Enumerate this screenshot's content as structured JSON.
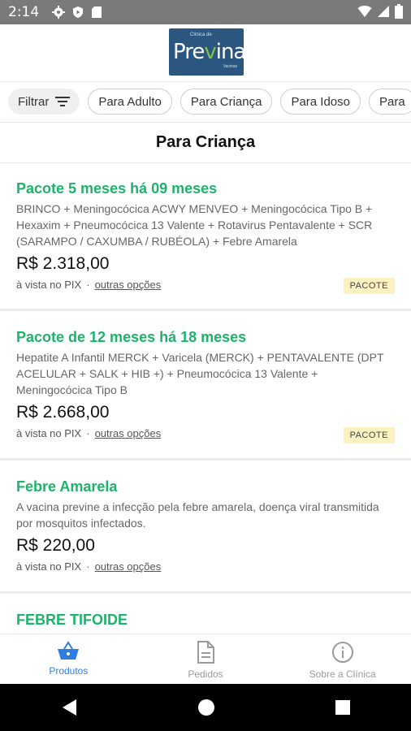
{
  "status_bar": {
    "time": "2:14"
  },
  "logo": {
    "mini_text": "Clínica de",
    "brand_part1": "Pre",
    "brand_part2": "v",
    "brand_part3": "ina",
    "sub_text": "Vacinas"
  },
  "filters": {
    "filter_label": "Filtrar",
    "chips": [
      "Para Adulto",
      "Para Criança",
      "Para Idoso",
      "Para"
    ]
  },
  "section": {
    "title": "Para Criança"
  },
  "products": [
    {
      "name": "Pacote 5 meses há 09 meses",
      "description": "BRINCO + Meningocócica ACWY MENVEO + Meningocócica Tipo B + Hexaxim + Pneumocócica 13 Valente + Rotavirus Pentavalente + SCR (SARAMPO / CAXUMBA / RUBÉOLA) + Febre Amarela",
      "price": "R$ 2.318,00",
      "payment": "à vista no PIX",
      "sep": "·",
      "options_link": "outras opções",
      "badge": "PACOTE"
    },
    {
      "name": "Pacote de 12 meses há 18 meses",
      "description": "Hepatite A Infantil MERCK + Varicela (MERCK) + PENTAVALENTE (DPT ACELULAR + SALK + HIB +) + Pneumocócica 13 Valente + Meningocócica Tipo B",
      "price": "R$ 2.668,00",
      "payment": "à vista no PIX",
      "sep": "·",
      "options_link": "outras opções",
      "badge": "PACOTE"
    },
    {
      "name": "Febre Amarela",
      "description": "A vacina previne a infecção pela febre amarela, doença viral transmitida por mosquitos infectados.",
      "price": "R$ 220,00",
      "payment": "à vista no PIX",
      "sep": "·",
      "options_link": "outras opções"
    },
    {
      "name": "FEBRE TIFOIDE"
    }
  ],
  "tabbar": {
    "tabs": [
      {
        "label": "Produtos",
        "icon": "basket-icon",
        "active": true
      },
      {
        "label": "Pedidos",
        "icon": "document-icon",
        "active": false
      },
      {
        "label": "Sobre a Clínica",
        "icon": "info-icon",
        "active": false
      }
    ]
  },
  "colors": {
    "accent_green": "#1db36b",
    "tab_active": "#2f7de1",
    "badge_bg": "#fcf2bf",
    "logo_bg": "#2a5680"
  }
}
